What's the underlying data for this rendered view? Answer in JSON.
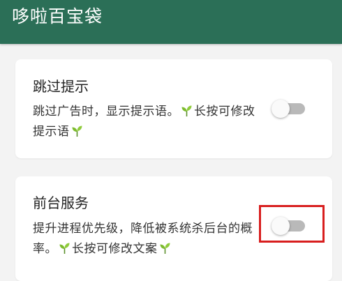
{
  "app_bar": {
    "title": "哆啦百宝袋",
    "background_color": "#2b6f57"
  },
  "settings": [
    {
      "title": "跳过提示",
      "desc_parts": [
        "跳过广告时，显示提示语。",
        "长按可修改提示语"
      ],
      "toggle_on": false
    },
    {
      "title": "前台服务",
      "desc_parts": [
        "提升进程优先级，降低被系统杀后台的概率。",
        "长按可修改文案"
      ],
      "toggle_on": false
    }
  ],
  "icons": {
    "sprout": "sprout-icon"
  },
  "colors": {
    "highlight": "#d81e1e",
    "switch_track_off": "#b9b9b9"
  }
}
